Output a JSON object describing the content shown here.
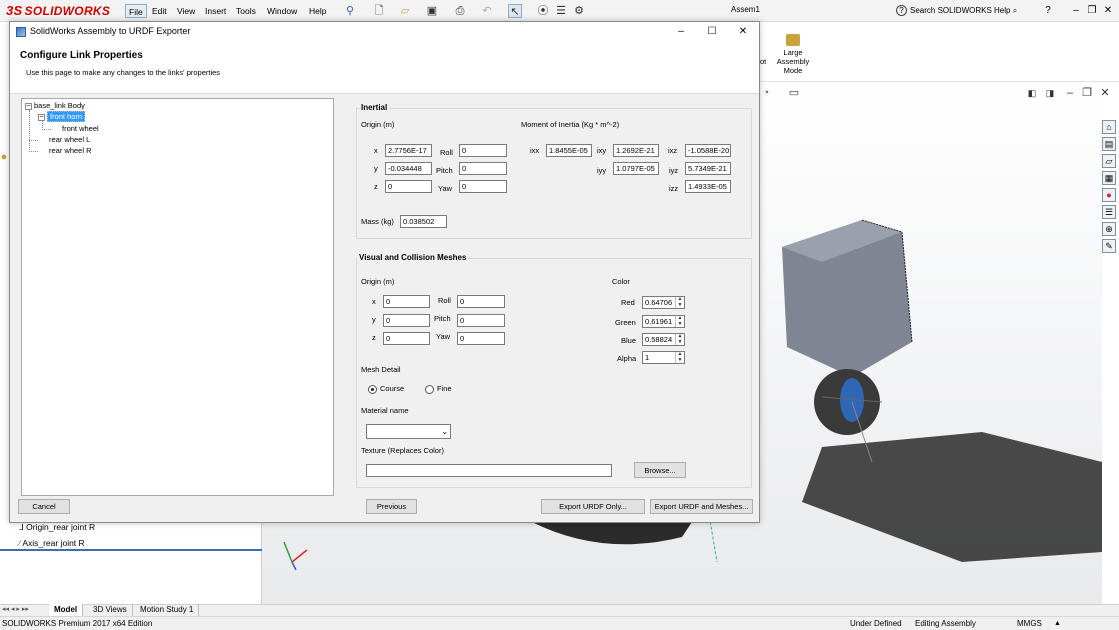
{
  "app": {
    "logo": "SOLIDWORKS",
    "logo_prefix": "3S",
    "doc_title": "Assem1",
    "help_search": "Search SOLIDWORKS Help",
    "menu": [
      "File",
      "Edit",
      "View",
      "Insert",
      "Tools",
      "Window",
      "Help"
    ],
    "ribbon": {
      "large_assembly": "Large Assembly Mode",
      "cut_label": "ot"
    }
  },
  "feature_tree": {
    "items": [
      "Origin_rear joint R",
      "Axis_rear joint R"
    ]
  },
  "bottom_tabs": [
    "Model",
    "3D Views",
    "Motion Study 1"
  ],
  "status": {
    "edition": "SOLIDWORKS Premium 2017 x64 Edition",
    "state": "Under Defined",
    "mode": "Editing Assembly",
    "units": "MMGS"
  },
  "dialog": {
    "title": "SolidWorks Assembly to URDF Exporter",
    "heading": "Configure Link Properties",
    "subheading": "Use this page to make any changes to the links' properties",
    "tree": {
      "root": "base_link Body",
      "selected": "front horn",
      "child": "front wheel",
      "siblings": [
        "rear wheel L",
        "rear wheel R"
      ]
    },
    "inertial": {
      "title": "Inertial",
      "origin_label": "Origin (m)",
      "x_label": "x",
      "y_label": "y",
      "z_label": "z",
      "roll_label": "Roll",
      "pitch_label": "Pitch",
      "yaw_label": "Yaw",
      "x": "2.7756E-17",
      "y": "-0.034448",
      "z": "0",
      "roll": "0",
      "pitch": "0",
      "yaw": "0",
      "moi_label": "Moment of Inertia (Kg * m^-2)",
      "ixx_label": "ixx",
      "ixy_label": "ixy",
      "ixz_label": "ixz",
      "iyy_label": "iyy",
      "iyz_label": "iyz",
      "izz_label": "izz",
      "ixx": "1.8455E-05",
      "ixy": "1.2692E-21",
      "ixz": "-1.0588E-20",
      "iyy": "1.0797E-05",
      "iyz": "5.7349E-21",
      "izz": "1.4933E-05",
      "mass_label": "Mass (kg)",
      "mass": "0.038502"
    },
    "visual": {
      "title": "Visual and Collision Meshes",
      "origin_label": "Origin (m)",
      "x": "0",
      "y": "0",
      "z": "0",
      "roll": "0",
      "pitch": "0",
      "yaw": "0",
      "color_label": "Color",
      "red_label": "Red",
      "green_label": "Green",
      "blue_label": "Blue",
      "alpha_label": "Alpha",
      "red": "0.64706",
      "green": "0.61961",
      "blue": "0.58824",
      "alpha": "1",
      "mesh_detail_label": "Mesh Detail",
      "course_label": "Course",
      "fine_label": "Fine",
      "material_label": "Material name",
      "material_value": "",
      "texture_label": "Texture (Replaces Color)",
      "texture_value": "",
      "browse": "Browse..."
    },
    "buttons": {
      "cancel": "Cancel",
      "previous": "Previous",
      "export_urdf": "Export URDF Only...",
      "export_meshes": "Export  URDF  and Meshes..."
    }
  }
}
